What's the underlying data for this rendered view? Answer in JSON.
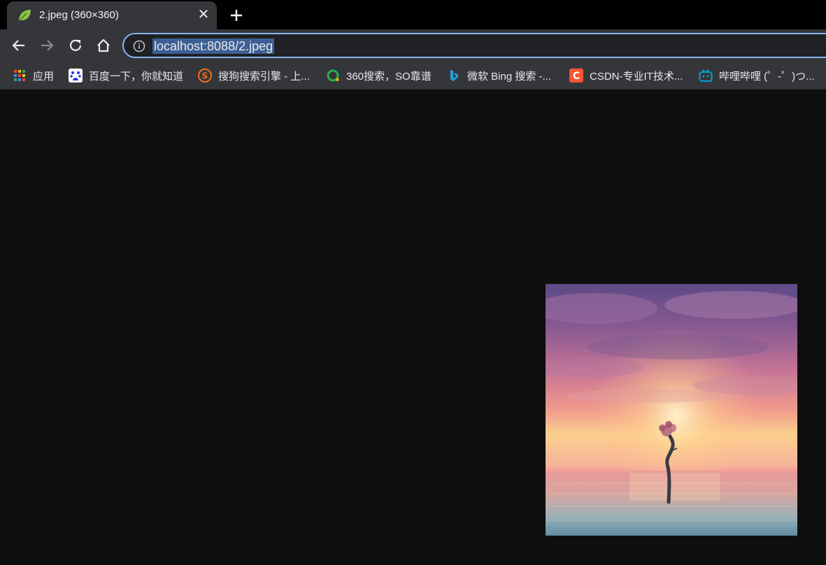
{
  "tab": {
    "title": "2.jpeg (360×360)",
    "favicon": "leaf-icon",
    "close_icon": "close-icon"
  },
  "new_tab_icon": "plus-icon",
  "toolbar": {
    "back_icon": "back-arrow-icon",
    "forward_icon": "forward-arrow-icon",
    "reload_icon": "reload-icon",
    "home_icon": "home-icon",
    "info_icon": "info-icon",
    "url": "localhost:8088/2.jpeg"
  },
  "bookmarks": [
    {
      "label": "应用",
      "icon": "apps-grid-icon"
    },
    {
      "label": "百度一下，你就知道",
      "icon": "baidu-icon"
    },
    {
      "label": "搜狗搜索引擎 - 上...",
      "icon": "sogou-icon"
    },
    {
      "label": "360搜索，SO靠谱",
      "icon": "360-search-icon"
    },
    {
      "label": "微软 Bing 搜索 -...",
      "icon": "bing-icon"
    },
    {
      "label": "CSDN-专业IT技术...",
      "icon": "csdn-icon"
    },
    {
      "label": "哔哩哔哩 (゜-゜)つ...",
      "icon": "bilibili-icon"
    }
  ],
  "colors": {
    "page_background": "#0e0e0e",
    "toolbar": "#35363a",
    "omnibox_focus": "#8ab4f8"
  },
  "image": {
    "subject": "sunset-sea-tree-image"
  }
}
